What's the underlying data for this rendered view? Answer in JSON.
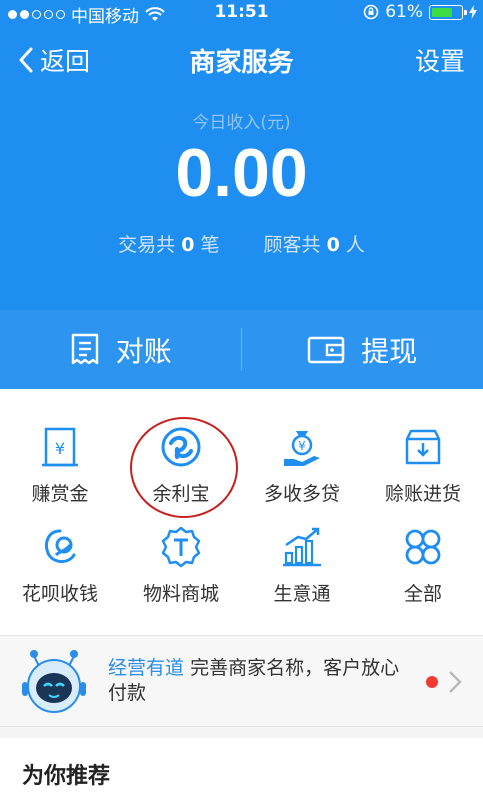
{
  "status_bar": {
    "carrier": "中国移动",
    "time": "11:51",
    "battery": "61%"
  },
  "nav": {
    "back_label": "返回",
    "title": "商家服务",
    "settings_label": "设置"
  },
  "income": {
    "label": "今日收入(元)",
    "amount": "0.00",
    "trade_prefix": "交易共",
    "trade_count": "0",
    "trade_unit": "笔",
    "customer_prefix": "顾客共",
    "customer_count": "0",
    "customer_unit": "人"
  },
  "actions": {
    "reconcile_label": "对账",
    "withdraw_label": "提现"
  },
  "services": [
    {
      "label": "赚赏金",
      "icon": "reward-bill-icon"
    },
    {
      "label": "余利宝",
      "icon": "yulibao-icon"
    },
    {
      "label": "多收多贷",
      "icon": "money-bag-hand-icon"
    },
    {
      "label": "赊账进货",
      "icon": "credit-box-icon"
    },
    {
      "label": "花呗收钱",
      "icon": "huabei-icon"
    },
    {
      "label": "物料商城",
      "icon": "t-badge-icon"
    },
    {
      "label": "生意通",
      "icon": "bar-chart-icon"
    },
    {
      "label": "全部",
      "icon": "four-petal-icon"
    }
  ],
  "banner": {
    "highlight": "经营有道",
    "text": "完善商家名称，客户放心付款"
  },
  "recommend": {
    "title": "为你推荐"
  },
  "colors": {
    "primary": "#1f8ef1",
    "accent_red": "#c81e1e"
  }
}
